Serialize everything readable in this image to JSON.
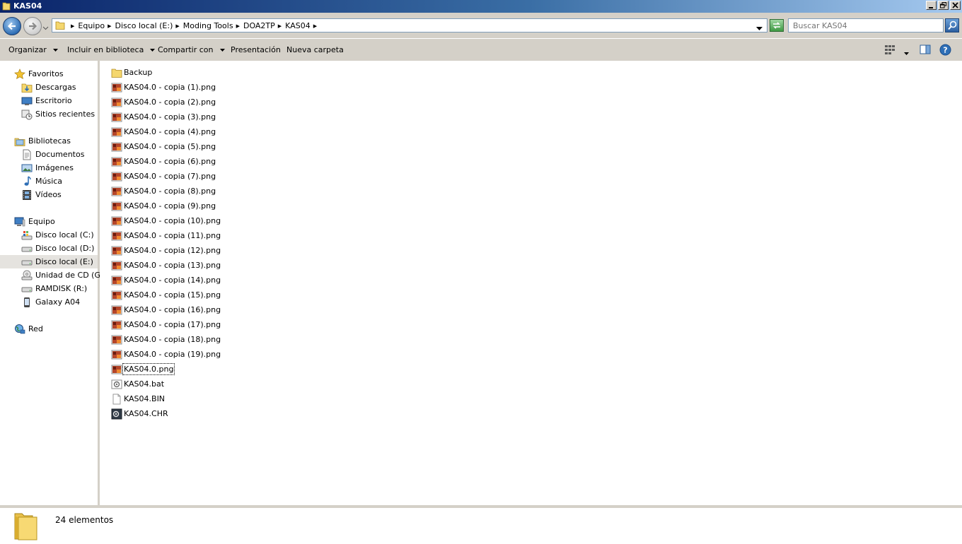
{
  "window": {
    "title": "KAS04"
  },
  "address": {
    "breadcrumbs": [
      "Equipo",
      "Disco local (E:)",
      "Moding Tools",
      "DOA2TP",
      "KAS04"
    ]
  },
  "search": {
    "placeholder": "Buscar KAS04"
  },
  "toolbar": {
    "organize": "Organizar",
    "include": "Incluir en biblioteca",
    "share": "Compartir con",
    "slideshow": "Presentación",
    "new_folder": "Nueva carpeta"
  },
  "nav": {
    "favorites": {
      "label": "Favoritos",
      "items": [
        "Descargas",
        "Escritorio",
        "Sitios recientes"
      ]
    },
    "libraries": {
      "label": "Bibliotecas",
      "items": [
        "Documentos",
        "Imágenes",
        "Música",
        "Vídeos"
      ]
    },
    "computer": {
      "label": "Equipo",
      "items": [
        "Disco local (C:)",
        "Disco local (D:)",
        "Disco local (E:)",
        "Unidad de CD (G:)",
        "RAMDISK (R:)",
        "Galaxy A04"
      ],
      "selected": "Disco local (E:)"
    },
    "network": {
      "label": "Red"
    }
  },
  "files": [
    {
      "name": "Backup",
      "type": "folder"
    },
    {
      "name": "KAS04.0 - copia (1).png",
      "type": "png"
    },
    {
      "name": "KAS04.0 - copia (2).png",
      "type": "png"
    },
    {
      "name": "KAS04.0 - copia (3).png",
      "type": "png"
    },
    {
      "name": "KAS04.0 - copia (4).png",
      "type": "png"
    },
    {
      "name": "KAS04.0 - copia (5).png",
      "type": "png"
    },
    {
      "name": "KAS04.0 - copia (6).png",
      "type": "png"
    },
    {
      "name": "KAS04.0 - copia (7).png",
      "type": "png"
    },
    {
      "name": "KAS04.0 - copia (8).png",
      "type": "png"
    },
    {
      "name": "KAS04.0 - copia (9).png",
      "type": "png"
    },
    {
      "name": "KAS04.0 - copia (10).png",
      "type": "png"
    },
    {
      "name": "KAS04.0 - copia (11).png",
      "type": "png"
    },
    {
      "name": "KAS04.0 - copia (12).png",
      "type": "png"
    },
    {
      "name": "KAS04.0 - copia (13).png",
      "type": "png"
    },
    {
      "name": "KAS04.0 - copia (14).png",
      "type": "png"
    },
    {
      "name": "KAS04.0 - copia (15).png",
      "type": "png"
    },
    {
      "name": "KAS04.0 - copia (16).png",
      "type": "png"
    },
    {
      "name": "KAS04.0 - copia (17).png",
      "type": "png"
    },
    {
      "name": "KAS04.0 - copia (18).png",
      "type": "png"
    },
    {
      "name": "KAS04.0 - copia (19).png",
      "type": "png"
    },
    {
      "name": "KAS04.0.png",
      "type": "png"
    },
    {
      "name": "KAS04.bat",
      "type": "bat"
    },
    {
      "name": "KAS04.BIN",
      "type": "bin"
    },
    {
      "name": "KAS04.CHR",
      "type": "chr"
    }
  ],
  "focused_file": "KAS04.0.png",
  "status": {
    "count_text": "24 elementos"
  },
  "icons": {
    "title": "folder-icon",
    "back": "back-arrow-icon",
    "forward": "forward-arrow-icon",
    "refresh": "refresh-icon",
    "search": "magnifier-icon",
    "views": "view-grid-icon",
    "preview_pane": "preview-pane-icon",
    "help": "help-icon"
  },
  "colors": {
    "titlebar_start": "#0a246a",
    "titlebar_end": "#a6caf0",
    "chrome": "#d4d0c8",
    "selected_nav": "#e5e3df"
  }
}
